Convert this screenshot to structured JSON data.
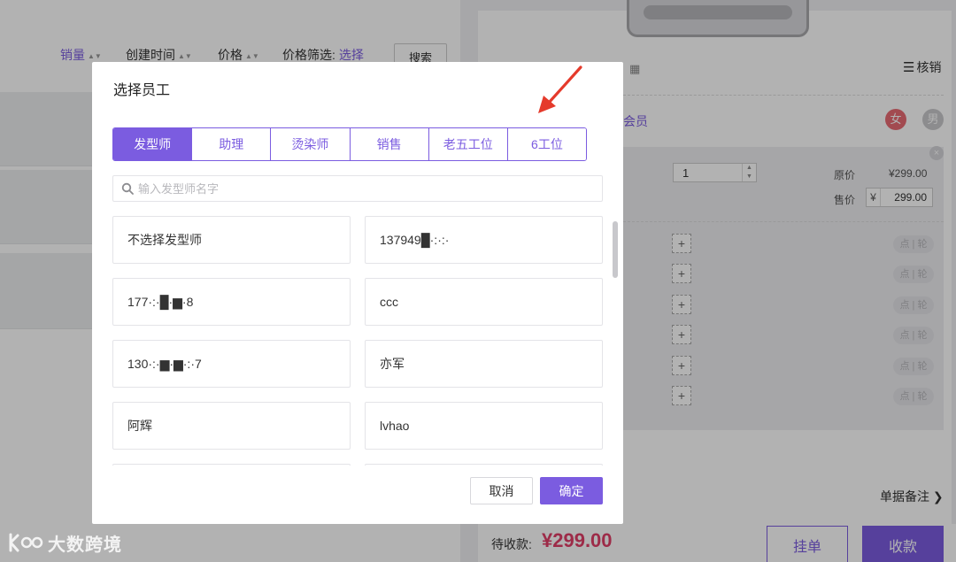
{
  "filter_bar": {
    "sales_label": "销量",
    "created_label": "创建时间",
    "price_label": "价格",
    "price_filter_label": "价格筛选:",
    "price_filter_link": "选择",
    "search_button": "搜索",
    "sort_icon": "sort-icon"
  },
  "cart": {
    "verify_label": "核销",
    "member_link": "会员",
    "gender_female": "女",
    "gender_male": "男",
    "quantity": "1",
    "original_price_label": "原价",
    "original_price_value": "¥299.00",
    "sale_price_label": "售价",
    "sale_currency": "¥",
    "sale_price_value": "299.00",
    "add_symbol": "+",
    "toggle_options": "点 | 轮",
    "remark_label": "单据备注",
    "due_label": "待收款:",
    "due_amount": "¥299.00",
    "hold_button": "挂单",
    "checkout_button": "收款"
  },
  "dialog": {
    "title": "选择员工",
    "tabs": [
      {
        "label": "发型师",
        "active": true
      },
      {
        "label": "助理",
        "active": false
      },
      {
        "label": "烫染师",
        "active": false
      },
      {
        "label": "销售",
        "active": false
      },
      {
        "label": "老五工位",
        "active": false
      },
      {
        "label": "6工位",
        "active": false
      }
    ],
    "search_placeholder": "输入发型师名字",
    "staff": [
      "不选择发型师",
      "137949█·:·:·",
      "177·:·█·▆·8",
      "ccc",
      "130·:·▆·▆·:·7",
      "亦军",
      "阿辉",
      "lvhao",
      "",
      ""
    ],
    "cancel_button": "取消",
    "confirm_button": "确定"
  },
  "watermark": {
    "text": "大数跨境"
  },
  "colors": {
    "accent": "#7b5ce0",
    "price_red": "#e13e68",
    "female": "#e96a73",
    "annotation_arrow": "#e53a2b"
  }
}
